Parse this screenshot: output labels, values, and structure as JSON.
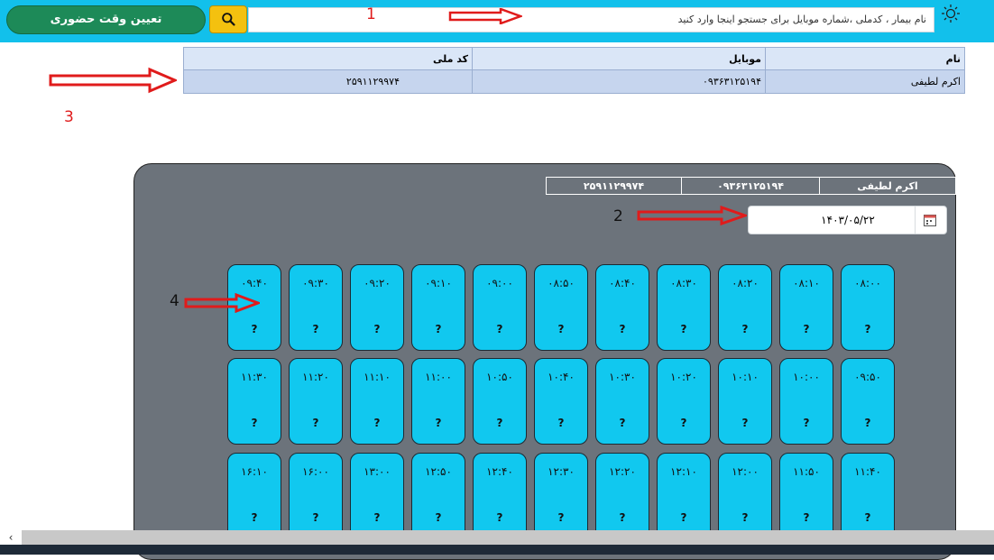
{
  "header": {
    "search_placeholder": "نام بیمار ، کدملی ،شماره موبایل    برای جستجو اینجا وارد کنید",
    "primary_button": "تعیین وقت حضوری",
    "icons": {
      "theme": "sun-icon",
      "search": "search-icon"
    }
  },
  "annotations": {
    "a1": "1",
    "a2": "2",
    "a3": "3",
    "a4": "4"
  },
  "patient_table": {
    "headers": [
      "نام",
      "موبایل",
      "کد ملی"
    ],
    "row": [
      "اکرم لطیفی",
      "۰۹۳۶۳۱۲۵۱۹۴",
      "۲۵۹۱۱۲۹۹۷۴"
    ]
  },
  "panel": {
    "info": [
      "اکرم لطیفی",
      "۰۹۳۶۳۱۲۵۱۹۴",
      "۲۵۹۱۱۲۹۹۷۴"
    ],
    "date": "۱۴۰۳/۰۵/۲۲",
    "slots": [
      [
        "۰۸:۰۰",
        "۰۸:۱۰",
        "۰۸:۲۰",
        "۰۸:۳۰",
        "۰۸:۴۰",
        "۰۸:۵۰",
        "۰۹:۰۰",
        "۰۹:۱۰",
        "۰۹:۲۰",
        "۰۹:۳۰",
        "۰۹:۴۰"
      ],
      [
        "۰۹:۵۰",
        "۱۰:۰۰",
        "۱۰:۱۰",
        "۱۰:۲۰",
        "۱۰:۳۰",
        "۱۰:۴۰",
        "۱۰:۵۰",
        "۱۱:۰۰",
        "۱۱:۱۰",
        "۱۱:۲۰",
        "۱۱:۳۰"
      ],
      [
        "۱۱:۴۰",
        "۱۱:۵۰",
        "۱۲:۰۰",
        "۱۲:۱۰",
        "۱۲:۲۰",
        "۱۲:۳۰",
        "۱۲:۴۰",
        "۱۲:۵۰",
        "۱۳:۰۰",
        "۱۶:۰۰",
        "۱۶:۱۰"
      ]
    ],
    "slot_status": "?"
  },
  "colors": {
    "topbar": "#12c0eb",
    "panel": "#6c737b",
    "slot": "#11c8ef",
    "primary": "#1d8a58",
    "search_button": "#f4c10f",
    "annotation": "#e01b1b"
  }
}
